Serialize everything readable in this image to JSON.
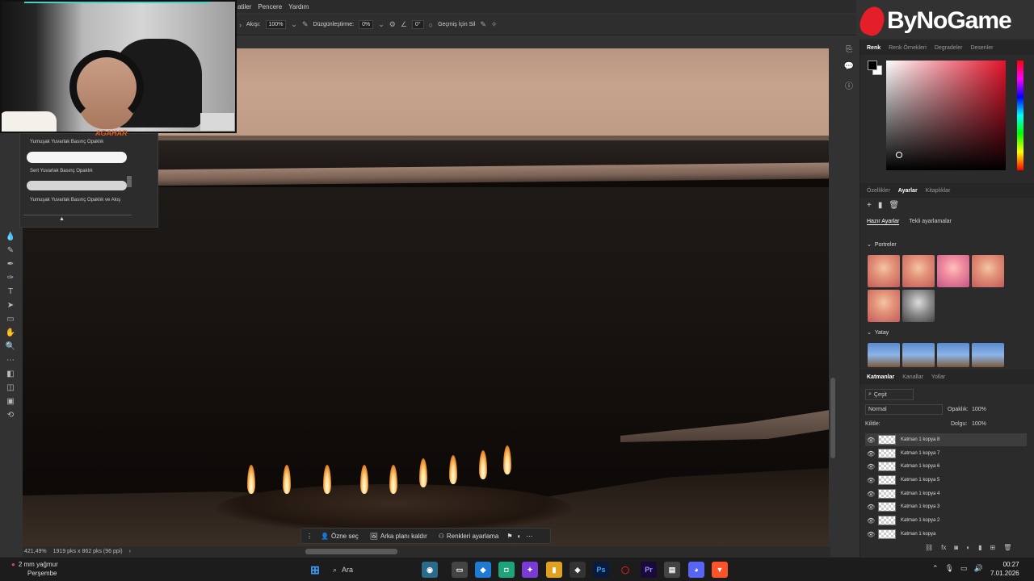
{
  "menu": {
    "items": [
      "atiler",
      "Pencere",
      "Yardım"
    ]
  },
  "options": {
    "flow_label": "Akışı:",
    "flow_value": "100%",
    "smoothing_label": "Düzgünleştirme:",
    "smoothing_value": "0%",
    "angle_value": "0°",
    "history_label": "Geçmiş İçin Sil"
  },
  "brushes": {
    "items": [
      "Yumuşak Yuvarlak Basınç Opaklık",
      "Sert Yuvarlak Basınç Opaklık",
      "Yumuşak Yuvarlak Basınç Opaklık ve Akış"
    ]
  },
  "webcam": {
    "overlay_text": "AGAHAR"
  },
  "logo": {
    "text": "ByNoGame"
  },
  "color_panel": {
    "tabs": [
      "Renk",
      "Renk Örnekleri",
      "Degradeler",
      "Desenler"
    ]
  },
  "adjust_panel": {
    "tabs": [
      "Özellikler",
      "Ayarlar",
      "Kitaplıklar"
    ],
    "subtabs": [
      "Hazır Ayarlar",
      "Tekli ayarlamalar"
    ],
    "section_portraits": "Portreler",
    "section_landscape": "Yatay"
  },
  "layers_panel": {
    "tabs": [
      "Katmanlar",
      "Kanallar",
      "Yollar"
    ],
    "filter_label": "Çeşit",
    "blend_mode": "Normal",
    "opacity_label": "Opaklık:",
    "opacity_value": "100%",
    "lock_label": "Kilitle:",
    "fill_label": "Dolgu:",
    "fill_value": "100%",
    "layers": [
      "Katman 1 kopya 8",
      "Katman 1 kopya 7",
      "Katman 1 kopya 6",
      "Katman 1 kopya 5",
      "Katman 1 kopya 4",
      "Katman 1 kopya 3",
      "Katman 1 kopya 2",
      "Katman 1 kopya"
    ]
  },
  "contextual_bar": {
    "select_subject": "Özne seç",
    "remove_bg": "Arka planı kaldır",
    "color_adjust": "Renkleri ayarlama"
  },
  "status": {
    "zoom": "421,49%",
    "doc_size": "1919 pks x 862 pks (96 ppi)"
  },
  "taskbar": {
    "weather_temp": "2 mm yağmur",
    "weather_day": "Perşembe",
    "search_placeholder": "Ara",
    "time": "00:27",
    "date": "7.01.2026"
  }
}
